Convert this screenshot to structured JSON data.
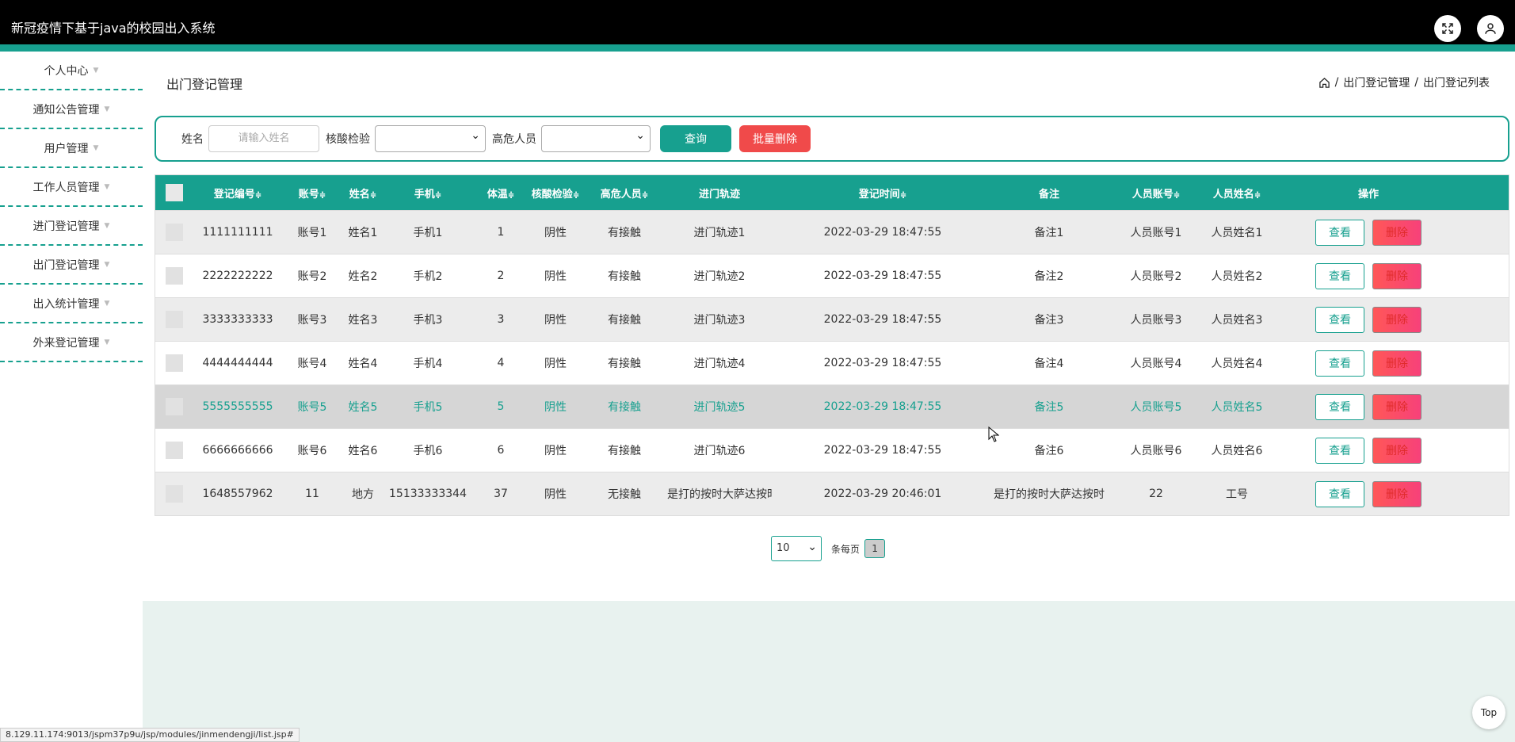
{
  "header": {
    "title": "新冠疫情下基于java的校园出入系统",
    "fullscreen_icon": "fullscreen-icon",
    "user_icon": "user-icon",
    "accent_color": "#17a08f"
  },
  "sidebar": {
    "items": [
      {
        "label": "个人中心"
      },
      {
        "label": "通知公告管理"
      },
      {
        "label": "用户管理"
      },
      {
        "label": "工作人员管理"
      },
      {
        "label": "进门登记管理"
      },
      {
        "label": "出门登记管理"
      },
      {
        "label": "出入统计管理"
      },
      {
        "label": "外来登记管理"
      }
    ]
  },
  "page": {
    "title": "出门登记管理",
    "breadcrumb": {
      "home_icon": "home-icon",
      "sep": "/",
      "level1": "出门登记管理",
      "level2": "出门登记列表"
    }
  },
  "search": {
    "name_label": "姓名",
    "name_placeholder": "请输入姓名",
    "nucleic_label": "核酸检验",
    "nucleic_value": "",
    "risk_label": "高危人员",
    "risk_value": "",
    "query_button": "查询",
    "bulk_delete_button": "批量删除"
  },
  "table": {
    "headers": [
      "登记编号",
      "账号",
      "姓名",
      "手机",
      "体温",
      "核酸检验",
      "高危人员",
      "进门轨迹",
      "登记时间",
      "备注",
      "人员账号",
      "人员姓名",
      "操作"
    ],
    "sort_glyph": "≑",
    "view_label": "查看",
    "delete_label": "删除",
    "rows": [
      {
        "id": "1111111111",
        "account": "账号1",
        "name": "姓名1",
        "phone": "手机1",
        "temp": "1",
        "nucleic": "阴性",
        "risk": "有接触",
        "track": "进门轨迹1",
        "time": "2022-03-29 18:47:55",
        "note": "备注1",
        "staff_account": "人员账号1",
        "staff_name": "人员姓名1"
      },
      {
        "id": "2222222222",
        "account": "账号2",
        "name": "姓名2",
        "phone": "手机2",
        "temp": "2",
        "nucleic": "阴性",
        "risk": "有接触",
        "track": "进门轨迹2",
        "time": "2022-03-29 18:47:55",
        "note": "备注2",
        "staff_account": "人员账号2",
        "staff_name": "人员姓名2"
      },
      {
        "id": "3333333333",
        "account": "账号3",
        "name": "姓名3",
        "phone": "手机3",
        "temp": "3",
        "nucleic": "阴性",
        "risk": "有接触",
        "track": "进门轨迹3",
        "time": "2022-03-29 18:47:55",
        "note": "备注3",
        "staff_account": "人员账号3",
        "staff_name": "人员姓名3"
      },
      {
        "id": "4444444444",
        "account": "账号4",
        "name": "姓名4",
        "phone": "手机4",
        "temp": "4",
        "nucleic": "阴性",
        "risk": "有接触",
        "track": "进门轨迹4",
        "time": "2022-03-29 18:47:55",
        "note": "备注4",
        "staff_account": "人员账号4",
        "staff_name": "人员姓名4"
      },
      {
        "id": "5555555555",
        "account": "账号5",
        "name": "姓名5",
        "phone": "手机5",
        "temp": "5",
        "nucleic": "阴性",
        "risk": "有接触",
        "track": "进门轨迹5",
        "time": "2022-03-29 18:47:55",
        "note": "备注5",
        "staff_account": "人员账号5",
        "staff_name": "人员姓名5"
      },
      {
        "id": "6666666666",
        "account": "账号6",
        "name": "姓名6",
        "phone": "手机6",
        "temp": "6",
        "nucleic": "阴性",
        "risk": "有接触",
        "track": "进门轨迹6",
        "time": "2022-03-29 18:47:55",
        "note": "备注6",
        "staff_account": "人员账号6",
        "staff_name": "人员姓名6"
      },
      {
        "id": "1648557962",
        "account": "11",
        "name": "地方",
        "phone": "15133333344",
        "temp": "37",
        "nucleic": "阴性",
        "risk": "无接触",
        "track": "是打的按时大萨达按时...",
        "time": "2022-03-29 20:46:01",
        "note": "是打的按时大萨达按时...",
        "staff_account": "22",
        "staff_name": "工号"
      }
    ]
  },
  "pagination": {
    "page_size": "10",
    "per_page_label": "条每页",
    "current_page": "1"
  },
  "status_bar": {
    "url": "8.129.11.174:9013/jspm37p9u/jsp/modules/jinmendengji/list.jsp#"
  },
  "top_button": "Top"
}
